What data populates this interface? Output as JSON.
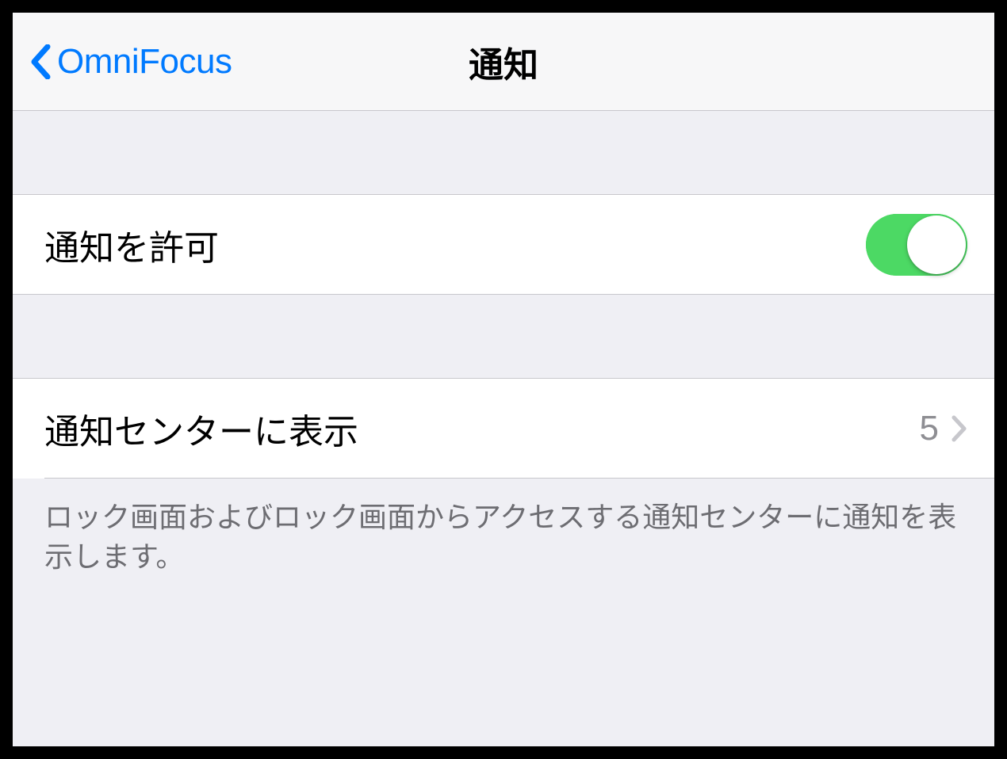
{
  "nav": {
    "back_label": "OmniFocus",
    "title": "通知"
  },
  "rows": {
    "allow_notifications": {
      "label": "通知を許可",
      "on": true
    },
    "notification_center": {
      "label": "通知センターに表示",
      "value": "5"
    }
  },
  "footer": "ロック画面およびロック画面からアクセスする通知センターに通知を表示します。",
  "colors": {
    "accent": "#007aff",
    "switch_on": "#4cd964",
    "background": "#efeff4",
    "cell_bg": "#ffffff",
    "separator": "#c8c7cc",
    "secondary_text": "#8e8e93"
  }
}
